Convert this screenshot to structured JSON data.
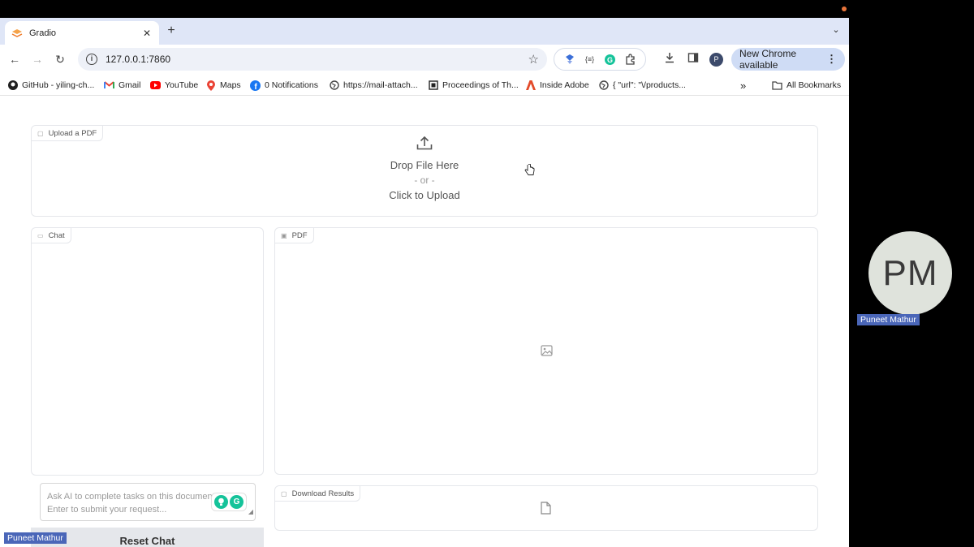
{
  "browser": {
    "tab": {
      "title": "Gradio"
    },
    "address": {
      "url": "127.0.0.1:7860"
    },
    "update_button": {
      "label": "New Chrome available"
    },
    "profile_initial": "P",
    "bookmarks": [
      {
        "label": "GitHub - yiling-ch...",
        "icon": "github-icon"
      },
      {
        "label": "Gmail",
        "icon": "gmail-icon"
      },
      {
        "label": "YouTube",
        "icon": "youtube-icon"
      },
      {
        "label": "Maps",
        "icon": "maps-icon"
      },
      {
        "label": "0 Notifications",
        "icon": "facebook-icon"
      },
      {
        "label": "https://mail-attach...",
        "icon": "globe-icon"
      },
      {
        "label": "Proceedings of Th...",
        "icon": "page-icon"
      },
      {
        "label": "Inside Adobe",
        "icon": "adobe-icon"
      },
      {
        "label": "{ \"url\": \"\\/products...",
        "icon": "globe-icon"
      }
    ],
    "all_bookmarks": "All Bookmarks"
  },
  "app": {
    "upload": {
      "label": "Upload a PDF",
      "drop_text": "Drop File Here",
      "or_text": "- or -",
      "click_text": "Click to Upload"
    },
    "chat": {
      "label": "Chat",
      "input_placeholder": "Ask AI to complete tasks on this document. Press Enter to submit your request...",
      "reset_label": "Reset Chat"
    },
    "pdf": {
      "label": "PDF"
    },
    "download": {
      "label": "Download Results"
    }
  },
  "participant": {
    "initials": "PM",
    "name": "Puneet Mathur"
  },
  "colors": {
    "accent": "#4a66b8",
    "tabstrip": "#dfe6f7",
    "update_button": "#cfdcf5"
  }
}
